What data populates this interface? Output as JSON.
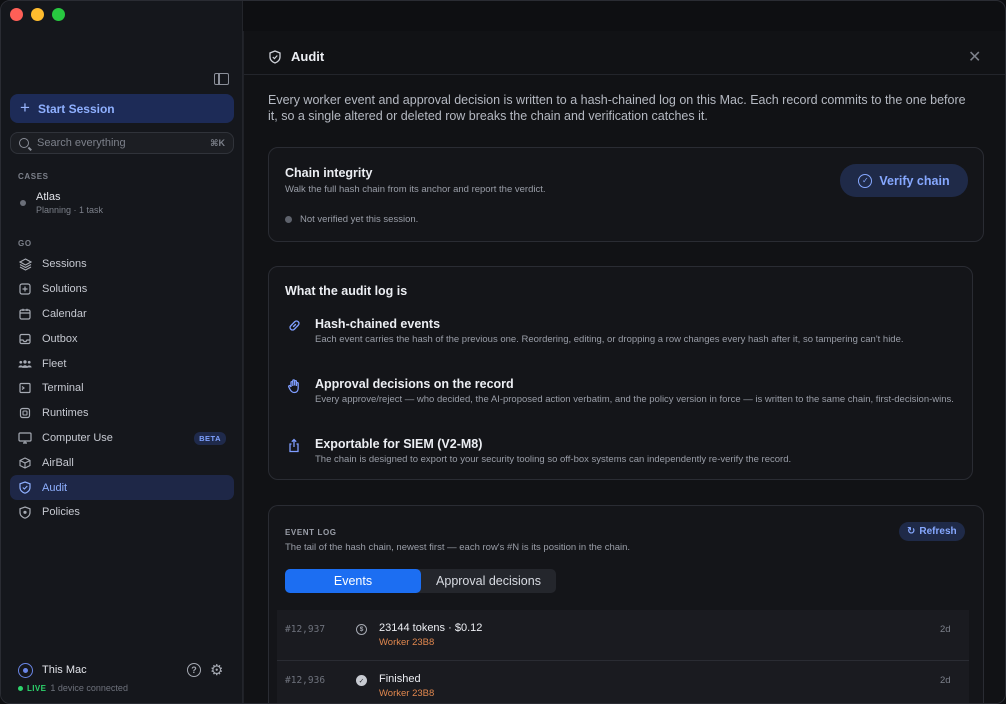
{
  "sidebar": {
    "start_session": "Start Session",
    "search_placeholder": "Search everything",
    "search_shortcut": "⌘K",
    "cases_label": "CASES",
    "case": {
      "name": "Atlas",
      "meta": "Planning · 1 task"
    },
    "go_label": "GO",
    "nav": [
      {
        "label": "Sessions",
        "icon": "layers-icon"
      },
      {
        "label": "Solutions",
        "icon": "box-icon"
      },
      {
        "label": "Calendar",
        "icon": "calendar-icon"
      },
      {
        "label": "Outbox",
        "icon": "inbox-icon"
      },
      {
        "label": "Fleet",
        "icon": "people-icon"
      },
      {
        "label": "Terminal",
        "icon": "terminal-icon"
      },
      {
        "label": "Runtimes",
        "icon": "chip-icon"
      },
      {
        "label": "Computer Use",
        "icon": "monitor-icon",
        "badge": "BETA"
      },
      {
        "label": "AirBall",
        "icon": "cube-icon"
      },
      {
        "label": "Audit",
        "icon": "shield-icon",
        "active": true
      },
      {
        "label": "Policies",
        "icon": "badge-icon"
      }
    ],
    "footer": {
      "machine": "This Mac",
      "live": "LIVE",
      "devices": "1 device connected"
    }
  },
  "main": {
    "title": "Audit",
    "intro": "Every worker event and approval decision is written to a hash-chained log on this Mac. Each record commits to the one before it, so a single altered or deleted row breaks the chain and verification catches it.",
    "chain": {
      "title": "Chain integrity",
      "subtitle": "Walk the full hash chain from its anchor and report the verdict.",
      "verify_label": "Verify chain",
      "status": "Not verified yet this session."
    },
    "what": {
      "title": "What the audit log is",
      "features": [
        {
          "title": "Hash-chained events",
          "desc": "Each event carries the hash of the previous one. Reordering, editing, or dropping a row changes every hash after it, so tampering can't hide."
        },
        {
          "title": "Approval decisions on the record",
          "desc": "Every approve/reject — who decided, the AI-proposed action verbatim, and the policy version in force — is written to the same chain, first-decision-wins."
        },
        {
          "title": "Exportable for SIEM (V2-M8)",
          "desc": "The chain is designed to export to your security tooling so off-box systems can independently re-verify the record."
        }
      ]
    },
    "log": {
      "label": "EVENT LOG",
      "subtitle": "The tail of the hash chain, newest first — each row's #N is its position in the chain.",
      "refresh": "Refresh",
      "tabs": [
        "Events",
        "Approval decisions"
      ],
      "rows": [
        {
          "num": "#12,937",
          "icon": "$",
          "title": "23144 tokens · $0.12",
          "worker": "Worker 23B8",
          "time": "2d"
        },
        {
          "num": "#12,936",
          "icon": "✓",
          "title": "Finished",
          "worker": "Worker 23B8",
          "time": "2d"
        }
      ]
    }
  },
  "colors": {
    "accent": "#86a8ff",
    "active_tab": "#1c6ef2",
    "worker": "#e0874e",
    "live": "#2dd46c"
  }
}
